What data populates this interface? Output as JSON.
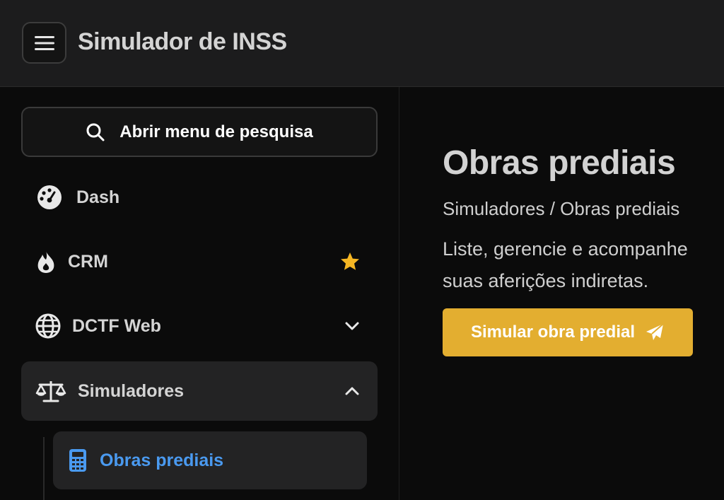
{
  "header": {
    "app_title": "Simulador de INSS",
    "menu_icon": "hamburger-icon"
  },
  "sidebar": {
    "search": {
      "label": "Abrir menu de pesquisa",
      "icon": "search-icon"
    },
    "items": [
      {
        "label": "Dash",
        "icon": "dashboard-gauge-icon"
      },
      {
        "label": "CRM",
        "icon": "flame-icon",
        "trailing_icon": "star-icon",
        "trailing_color": "#f5b623"
      },
      {
        "label": "DCTF Web",
        "icon": "globe-icon",
        "trailing_icon": "chevron-down-icon"
      },
      {
        "label": "Simuladores",
        "icon": "scale-icon",
        "trailing_icon": "chevron-up-icon",
        "expanded": true
      }
    ],
    "subitems": [
      {
        "label": "Obras prediais",
        "icon": "calculator-icon",
        "active": true,
        "color": "#4a9af0"
      }
    ]
  },
  "main": {
    "title": "Obras prediais",
    "breadcrumb": "Simuladores / Obras prediais",
    "description": "Liste, gerencie e acompanhe suas aferições indiretas.",
    "cta": {
      "label": "Simular obra predial",
      "icon": "paper-plane-icon",
      "color": "#e3ae30"
    }
  }
}
